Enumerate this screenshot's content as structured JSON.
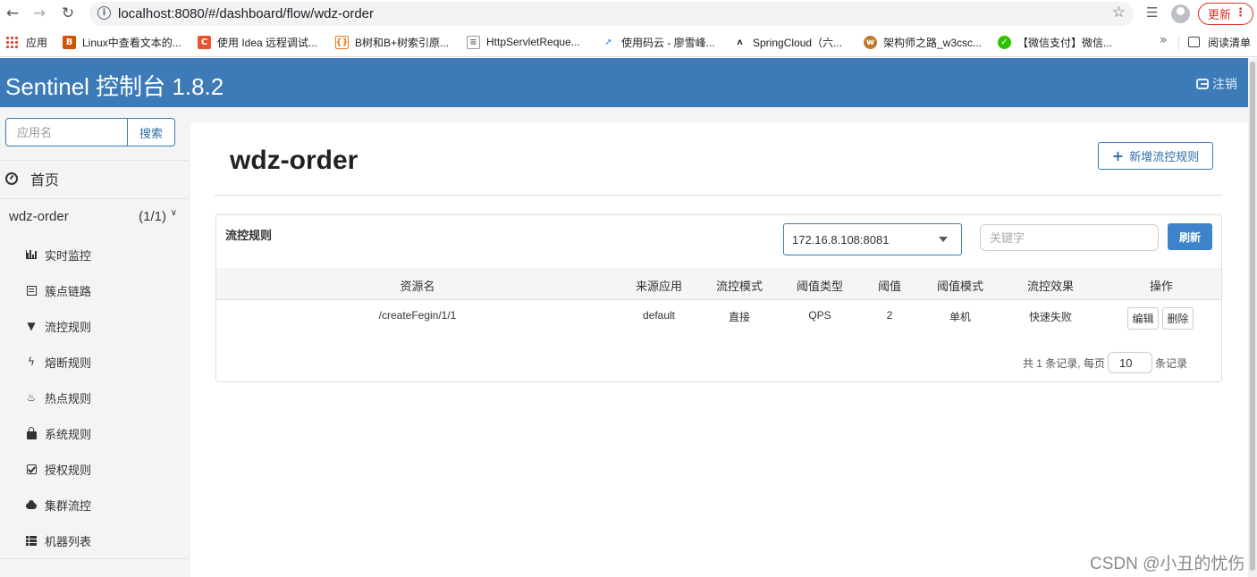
{
  "browser": {
    "url": "localhost:8080/#/dashboard/flow/wdz-order",
    "update_label": "更新",
    "bookmarks": [
      {
        "label": "应用",
        "icon": "apps-grid-icon"
      },
      {
        "label": "Linux中查看文本的...",
        "icon": "b-logo-icon"
      },
      {
        "label": "使用 Idea 远程调试...",
        "icon": "csdn-c-icon"
      },
      {
        "label": "B树和B+树索引原...",
        "icon": "bracket-icon"
      },
      {
        "label": "HttpServletReque...",
        "icon": "java-doc-icon"
      },
      {
        "label": "使用码云 - 廖雪峰...",
        "icon": "rocket-icon"
      },
      {
        "label": "SpringCloud（六...",
        "icon": "bird-icon"
      },
      {
        "label": "架构师之路_w3csc...",
        "icon": "w3c-icon"
      },
      {
        "label": "【微信支付】微信...",
        "icon": "wechat-icon"
      }
    ],
    "reading_list_label": "阅读清单"
  },
  "header": {
    "title": "Sentinel 控制台 1.8.2",
    "logout_label": "注销",
    "bg_color": "#3c7ab8"
  },
  "sidebar": {
    "search_placeholder": "应用名",
    "search_button": "搜索",
    "home_label": "首页",
    "app_name": "wdz-order",
    "app_count": "(1/1)",
    "menu": [
      {
        "label": "实时监控",
        "icon": "bar-chart-icon"
      },
      {
        "label": "簇点链路",
        "icon": "list-icon"
      },
      {
        "label": "流控规则",
        "icon": "filter-icon"
      },
      {
        "label": "熔断规则",
        "icon": "flash-icon"
      },
      {
        "label": "热点规则",
        "icon": "fire-icon"
      },
      {
        "label": "系统规则",
        "icon": "lock-icon"
      },
      {
        "label": "授权规则",
        "icon": "check-icon"
      },
      {
        "label": "集群流控",
        "icon": "cloud-icon"
      },
      {
        "label": "机器列表",
        "icon": "table-icon"
      }
    ]
  },
  "main": {
    "title": "wdz-order",
    "add_rule_button": "新增流控规则",
    "card_title": "流控规则",
    "machine_selected": "172.16.8.108:8081",
    "keyword_placeholder": "关键字",
    "refresh_button": "刷新",
    "columns": [
      "资源名",
      "来源应用",
      "流控模式",
      "阈值类型",
      "阈值",
      "阈值模式",
      "流控效果",
      "操作"
    ],
    "rows": [
      {
        "resource": "/createFegin/1/1",
        "origin": "default",
        "strategy": "直接",
        "grade": "QPS",
        "count": "2",
        "cluster_mode": "单机",
        "effect": "快速失败",
        "edit": "编辑",
        "delete": "删除"
      }
    ],
    "pager_prefix": "共 1 条记录, 每页",
    "page_size": "10",
    "pager_suffix": "条记录"
  },
  "watermark": "CSDN @小丑的忧伤"
}
